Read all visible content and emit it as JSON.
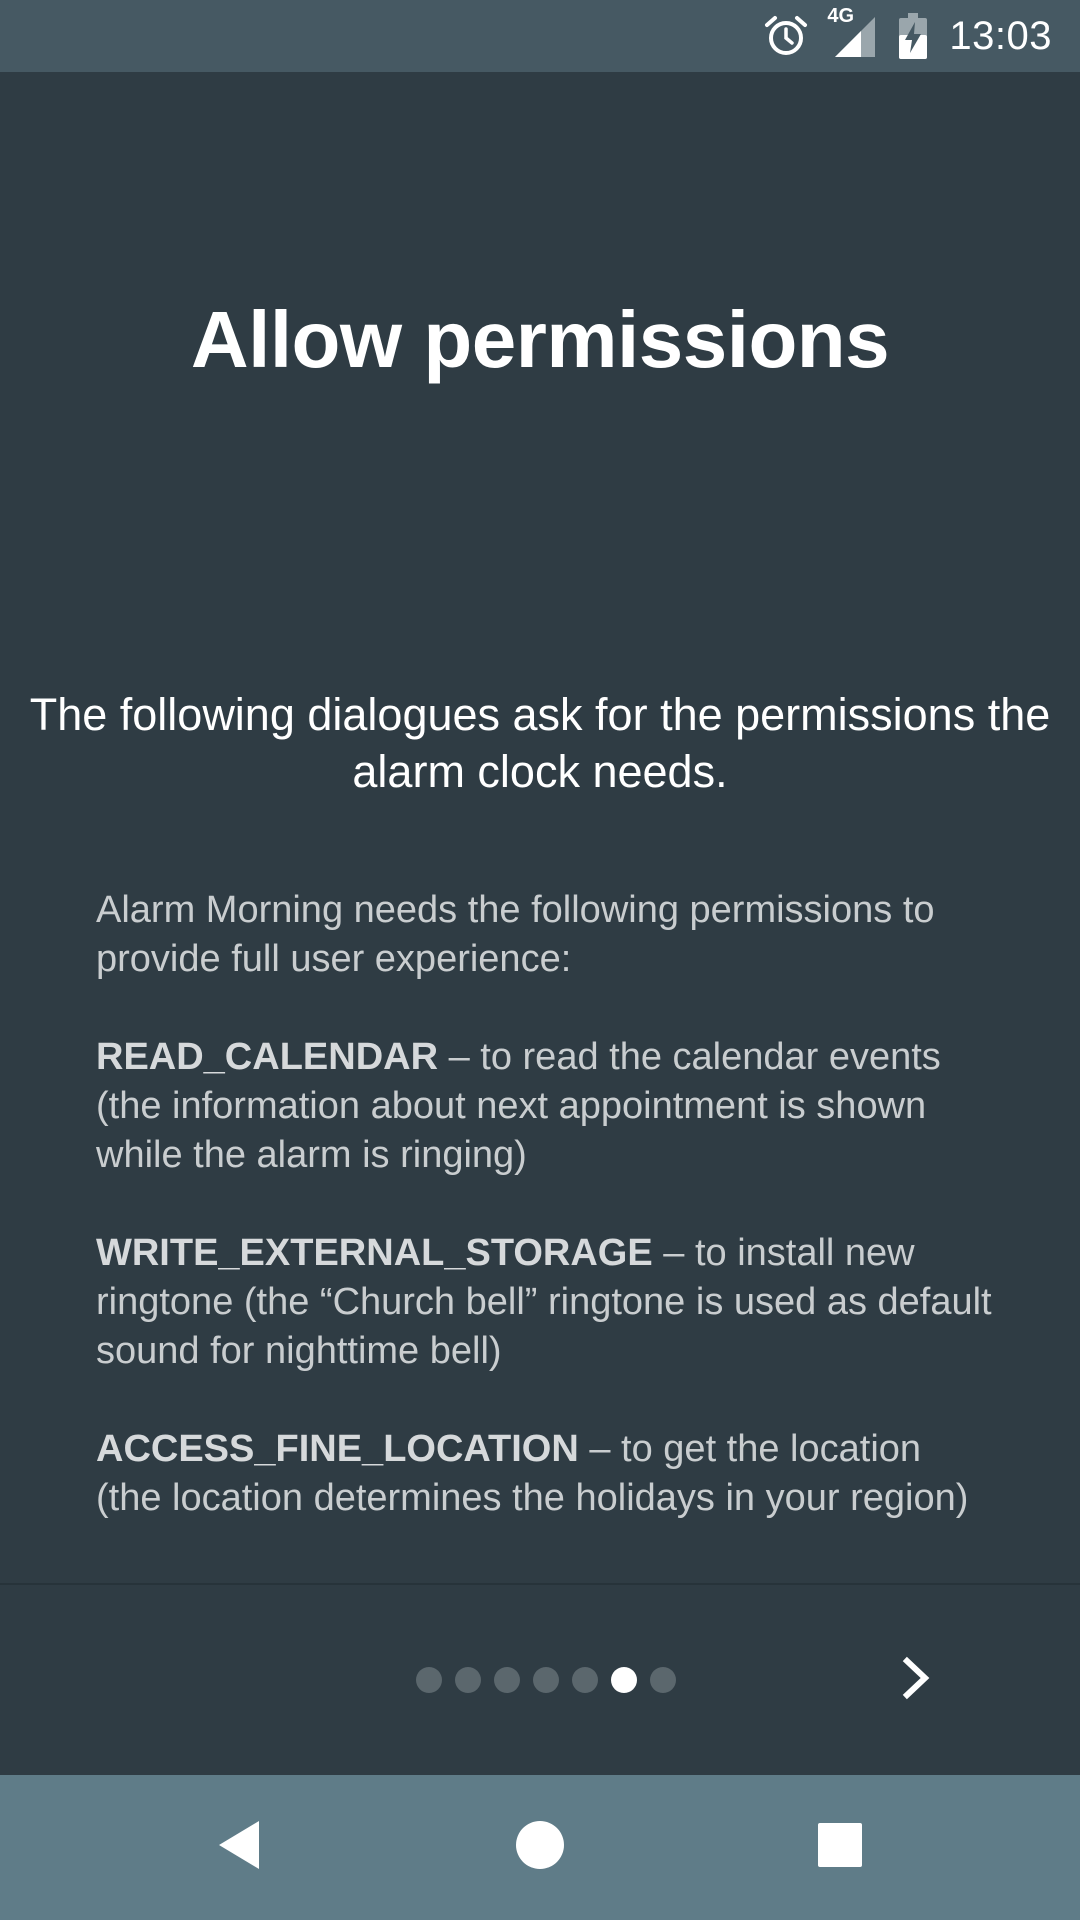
{
  "status_bar": {
    "network_label": "4G",
    "time": "13:03",
    "icons": [
      "alarm-icon",
      "signal-icon",
      "battery-charging-icon"
    ]
  },
  "screen": {
    "title": "Allow permissions",
    "subtitle": "The following dialogues ask for the permissions the alarm clock needs.",
    "intro": "Alarm Morning needs the following permissions to provide full user experience:",
    "permissions": [
      {
        "name": "READ_CALENDAR",
        "description": " – to read the calendar events (the information about next appointment is shown while the alarm is ringing)"
      },
      {
        "name": "WRITE_EXTERNAL_STORAGE",
        "description": " – to install new ringtone (the “Church bell” ringtone is used as default sound for nighttime bell)"
      },
      {
        "name": "ACCESS_FINE_LOCATION",
        "description": " – to get the location (the location determines the holidays in your region)"
      }
    ]
  },
  "pager": {
    "page_count": 7,
    "current_page": 6,
    "next_icon": "chevron-right-icon"
  },
  "nav_bar": {
    "icons": [
      "back-icon",
      "home-icon",
      "recents-icon"
    ]
  },
  "colors": {
    "background": "#2f3c44",
    "status_bar": "#465963",
    "nav_bar": "#5f7c88",
    "dot_inactive": "#5b676d",
    "dot_active": "#ffffff"
  }
}
